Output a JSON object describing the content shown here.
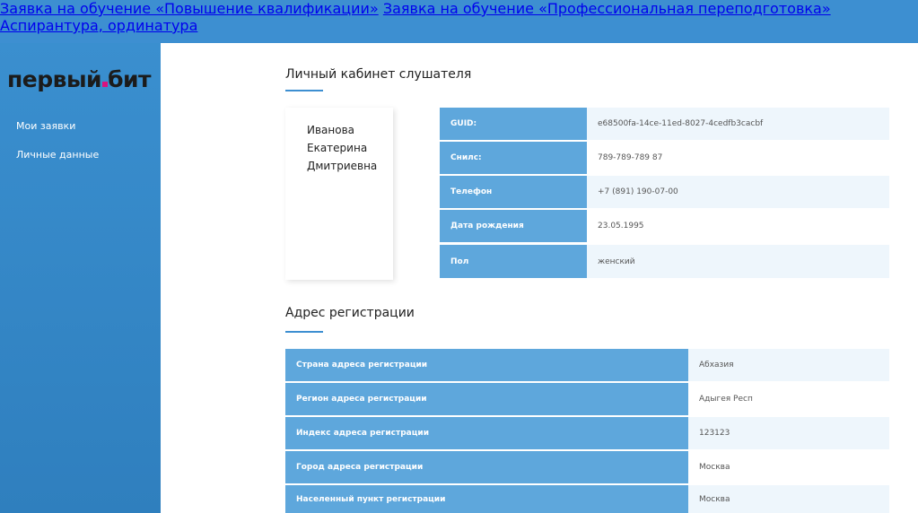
{
  "topnav": {
    "items": [
      "Заявка на обучение «Повышение квалификации»",
      "Заявка на обучение «Профессиональная переподготовка»",
      "Аспирантура, ординатура"
    ]
  },
  "logo": {
    "part1": "первый",
    "part2": "бит"
  },
  "sidebar": {
    "items": [
      "Мои заявки",
      "Личные данные"
    ]
  },
  "cabinet": {
    "title": "Личный кабинет слушателя",
    "name": [
      "Иванова",
      "Екатерина",
      "Дмитриевна"
    ],
    "rows": [
      {
        "label": "GUID:",
        "value": "e68500fa-14ce-11ed-8027-4cedfb3cacbf"
      },
      {
        "label": "Снилс:",
        "value": "789-789-789 87"
      },
      {
        "label": "Телефон",
        "value": "+7 (891) 190-07-00"
      },
      {
        "label": "Дата рождения",
        "value": "23.05.1995"
      },
      {
        "label": "Пол",
        "value": "женский"
      }
    ]
  },
  "address": {
    "title": "Адрес регистрации",
    "rows": [
      {
        "label": "Страна адреса регистрации",
        "value": "Абхазия"
      },
      {
        "label": "Регион адреса регистрации",
        "value": "Адыгея Респ"
      },
      {
        "label": "Индекс адреса регистрации",
        "value": "123123"
      },
      {
        "label": "Город адреса регистрации",
        "value": "Москва"
      },
      {
        "label": "Населенный пункт регистрации",
        "value": "Москва"
      }
    ]
  },
  "colors": {
    "accent": "#3d8fd1",
    "label_bg": "#5ea7dc",
    "value_bg": "#eef6fc",
    "logo_dot": "#d9127f"
  }
}
